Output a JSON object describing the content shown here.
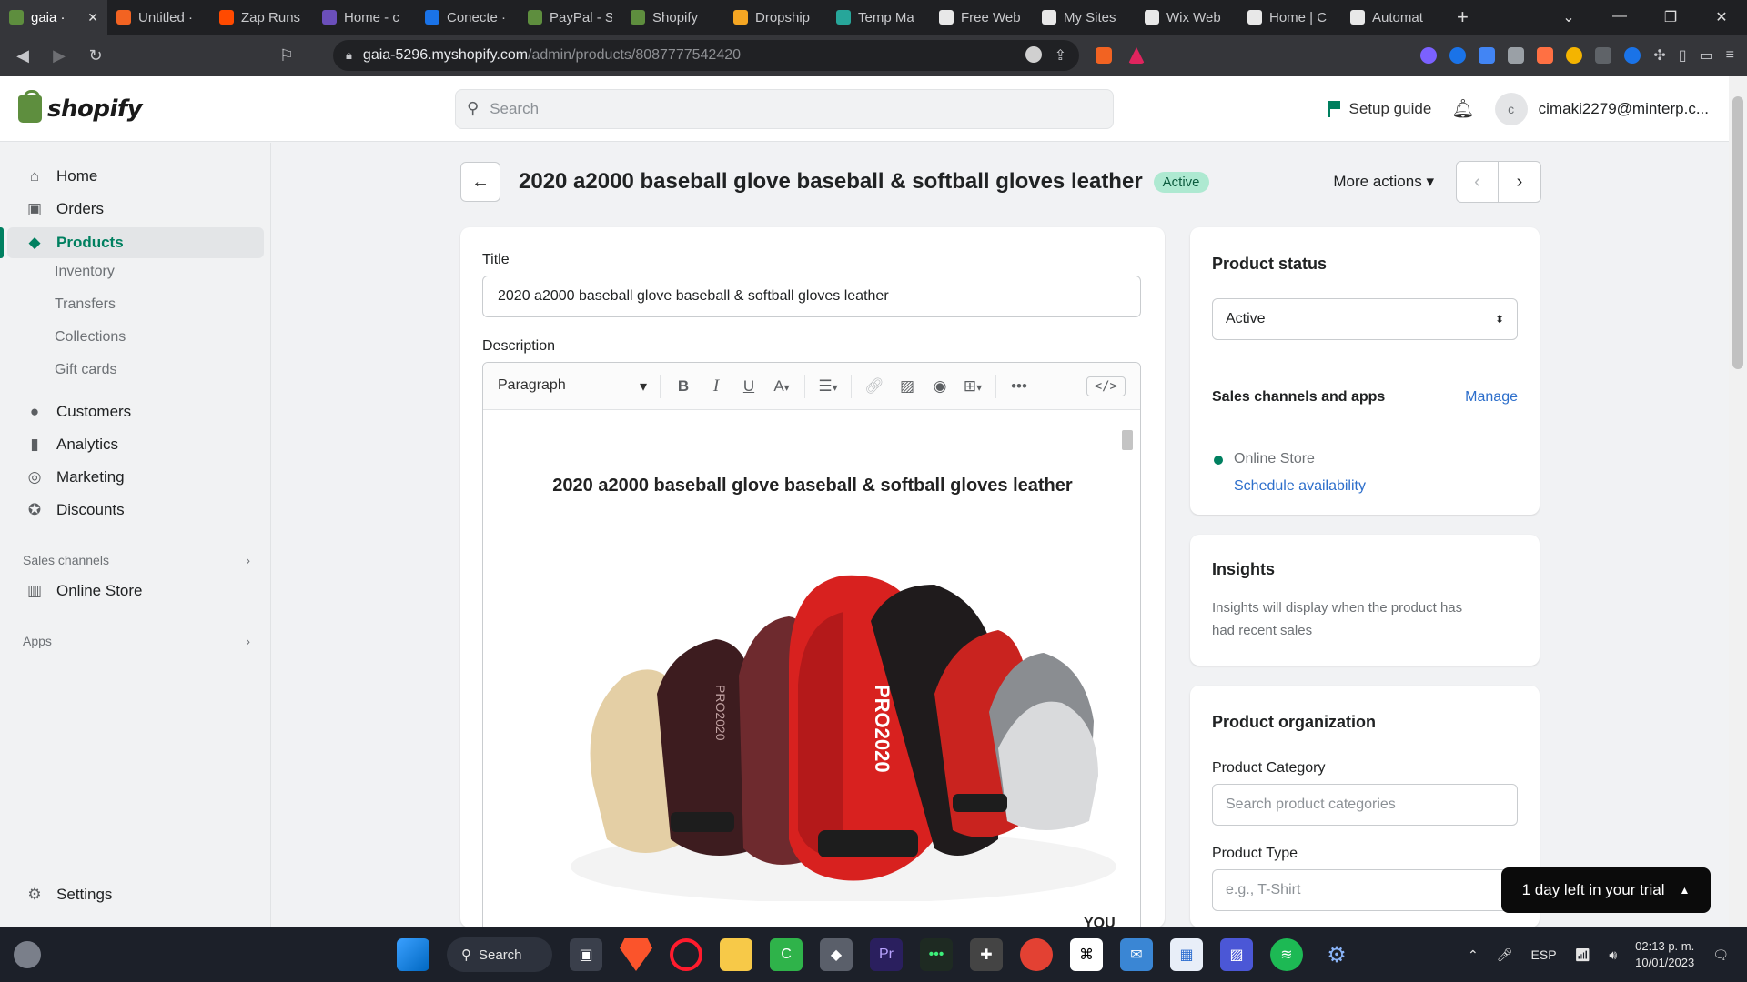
{
  "browser": {
    "tabs": [
      {
        "label": "gaia ·",
        "color": "#5e8e3e",
        "active": true
      },
      {
        "label": "Untitled ·",
        "color": "#f26322"
      },
      {
        "label": "Zap Runs",
        "color": "#ff4a00"
      },
      {
        "label": "Home - c",
        "color": "#6b4fbb"
      },
      {
        "label": "Conecte ·",
        "color": "#1a73e8"
      },
      {
        "label": "PayPal - S",
        "color": "#5e8e3e"
      },
      {
        "label": "Shopify",
        "color": "#5e8e3e"
      },
      {
        "label": "Dropship",
        "color": "#f5a623"
      },
      {
        "label": "Temp Ma",
        "color": "#27a69a"
      },
      {
        "label": "Free Web",
        "color": "#e8e8e8"
      },
      {
        "label": "My Sites",
        "color": "#e8e8e8"
      },
      {
        "label": "Wix Web",
        "color": "#e8e8e8"
      },
      {
        "label": "Home | C",
        "color": "#e8e8e8"
      },
      {
        "label": "Automat",
        "color": "#e8e8e8"
      }
    ],
    "url_host": "gaia-5296.myshopify.com",
    "url_path": "/admin/products/8087777542420"
  },
  "topbar": {
    "logo_text": "shopify",
    "search_placeholder": "Search",
    "setup_guide": "Setup guide",
    "account_initial": "c",
    "account_email": "cimaki2279@minterp.c..."
  },
  "sidebar": {
    "items": [
      {
        "label": "Home",
        "icon": "home-icon",
        "glyph": "⌂"
      },
      {
        "label": "Orders",
        "icon": "orders-icon",
        "glyph": "▣"
      },
      {
        "label": "Products",
        "icon": "tag-icon",
        "glyph": "◆",
        "active": true
      },
      {
        "label": "Customers",
        "icon": "person-icon",
        "glyph": "●"
      },
      {
        "label": "Analytics",
        "icon": "bar-chart-icon",
        "glyph": "▮"
      },
      {
        "label": "Marketing",
        "icon": "target-icon",
        "glyph": "◎"
      },
      {
        "label": "Discounts",
        "icon": "discount-icon",
        "glyph": "✪"
      }
    ],
    "sub_items": [
      "Inventory",
      "Transfers",
      "Collections",
      "Gift cards"
    ],
    "sales_channels_heading": "Sales channels",
    "online_store": "Online Store",
    "apps_heading": "Apps",
    "settings": "Settings"
  },
  "page": {
    "title": "2020 a2000 baseball glove baseball & softball gloves leather",
    "status_badge": "Active",
    "more_actions": "More actions"
  },
  "product_form": {
    "title_label": "Title",
    "title_value": "2020 a2000 baseball glove baseball & softball gloves leather",
    "description_label": "Description",
    "toolbar": {
      "paragraph": "Paragraph",
      "bold": "B",
      "italic": "I",
      "underline": "U",
      "text_color": "A",
      "more": "•••",
      "code": "</>"
    },
    "description_heading": "2020 a2000 baseball glove baseball & softball gloves leather",
    "glove_text": "PRO2020",
    "glove_text_2": "PRO2020",
    "trailing_text": "YOU"
  },
  "status_card": {
    "title": "Product status",
    "value": "Active",
    "sales_channels_title": "Sales channels and apps",
    "manage": "Manage",
    "channel": "Online Store",
    "schedule": "Schedule availability"
  },
  "insights_card": {
    "title": "Insights",
    "text": "Insights will display when the product has had recent sales"
  },
  "organization_card": {
    "title": "Product organization",
    "category_label": "Product Category",
    "category_placeholder": "Search product categories",
    "type_label": "Product Type",
    "type_placeholder": "e.g., T-Shirt"
  },
  "trial_banner": "1 day left in your trial",
  "taskbar": {
    "search": "Search",
    "lang": "ESP",
    "time": "02:13 p. m.",
    "date": "10/01/2023"
  },
  "colors": {
    "accent": "#008060",
    "badge_bg": "#aee9d1",
    "link": "#2c6ecb"
  }
}
